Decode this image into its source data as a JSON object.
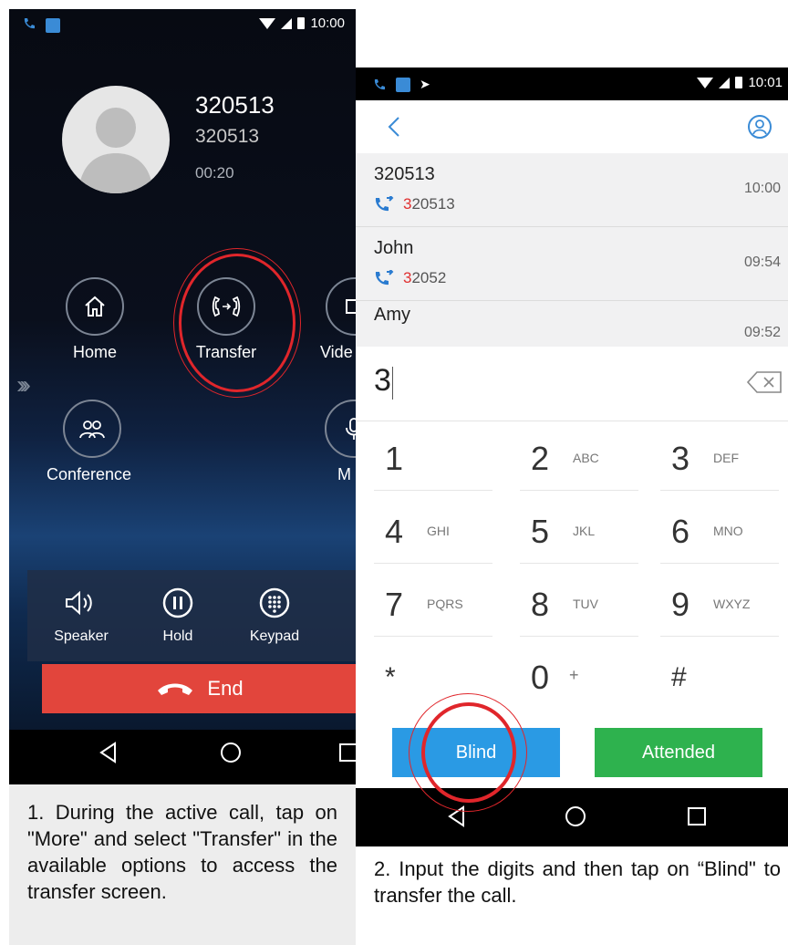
{
  "screen1": {
    "status_time": "10:00",
    "caller_name": "320513",
    "caller_number": "320513",
    "call_duration": "00:20",
    "actions": {
      "home": "Home",
      "transfer": "Transfer",
      "video": "Vide",
      "conference": "Conference",
      "mute": "M"
    },
    "controls": {
      "speaker": "Speaker",
      "hold": "Hold",
      "keypad": "Keypad"
    },
    "end_label": "End"
  },
  "screen2": {
    "status_time": "10:01",
    "contacts": [
      {
        "name": "320513",
        "number_match": "3",
        "number_rest": "20513",
        "time": "10:00"
      },
      {
        "name": "John",
        "number_match": "3",
        "number_rest": "2052",
        "time": "09:54"
      },
      {
        "name": "Amy",
        "number_match": "",
        "number_rest": "",
        "time": "09:52"
      }
    ],
    "dialed_digits": "3",
    "keys": [
      {
        "digit": "1",
        "letters": ""
      },
      {
        "digit": "2",
        "letters": "ABC"
      },
      {
        "digit": "3",
        "letters": "DEF"
      },
      {
        "digit": "4",
        "letters": "GHI"
      },
      {
        "digit": "5",
        "letters": "JKL"
      },
      {
        "digit": "6",
        "letters": "MNO"
      },
      {
        "digit": "7",
        "letters": "PQRS"
      },
      {
        "digit": "8",
        "letters": "TUV"
      },
      {
        "digit": "9",
        "letters": "WXYZ"
      },
      {
        "digit": "*",
        "letters": ""
      },
      {
        "digit": "0",
        "letters": "+"
      },
      {
        "digit": "#",
        "letters": ""
      }
    ],
    "blind_label": "Blind",
    "attended_label": "Attended"
  },
  "captions": {
    "step1": "1. During the active call, tap on \"More\" and select \"Transfer\" in the available options to access the transfer screen.",
    "step2": "2. Input the digits and then tap on “Blind\" to transfer the call."
  },
  "colors": {
    "end_red": "#e2453c",
    "blind_blue": "#2a9ae4",
    "attended_green": "#2eb24e",
    "annotation_red": "#e0262b",
    "accent_blue": "#3a8bd6"
  }
}
